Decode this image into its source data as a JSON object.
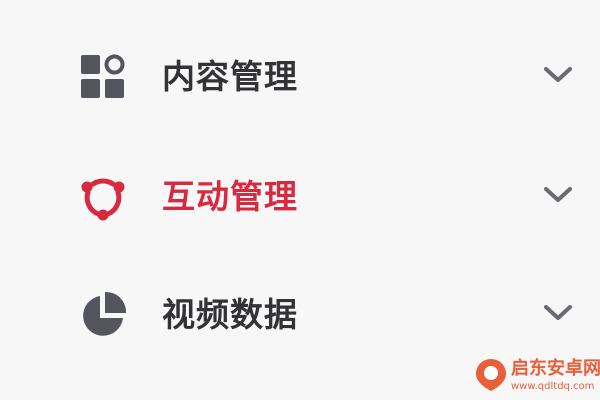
{
  "colors": {
    "default_text": "#333336",
    "default_icon": "#55565d",
    "active_text": "#d8293f",
    "active_icon": "#d8293f",
    "chevron": "#6a6b70",
    "watermark": "#e8603a"
  },
  "menu": {
    "items": [
      {
        "label": "内容管理",
        "icon": "grid-icon",
        "active": false
      },
      {
        "label": "互动管理",
        "icon": "share-icon",
        "active": true
      },
      {
        "label": "视频数据",
        "icon": "pie-chart-icon",
        "active": false
      }
    ]
  },
  "watermark": {
    "name": "启东安卓网",
    "url": "www.qdltdq.com",
    "icon": "watermark-logo-icon"
  }
}
